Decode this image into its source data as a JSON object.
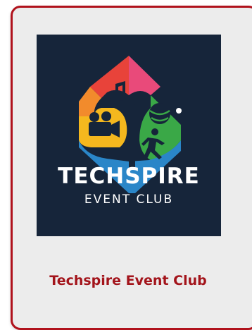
{
  "card": {
    "logo": {
      "brand_main": "TECHSPIRE",
      "brand_sub": "EVENT CLUB",
      "icons": [
        "music-note-icon",
        "movie-camera-icon",
        "sports-ball-icon",
        "runner-icon"
      ]
    },
    "title": "Techspire Event Club"
  },
  "colors": {
    "card_border": "#b0121c",
    "card_background": "#ececec",
    "logo_background": "#16253a",
    "title_text": "#a3141b",
    "segment_red": "#e63a4a",
    "segment_orange": "#f28b2c",
    "segment_yellow": "#f5b81e",
    "segment_green": "#3aa847",
    "segment_blue": "#2a86c8",
    "segment_pink": "#e94a7a"
  }
}
